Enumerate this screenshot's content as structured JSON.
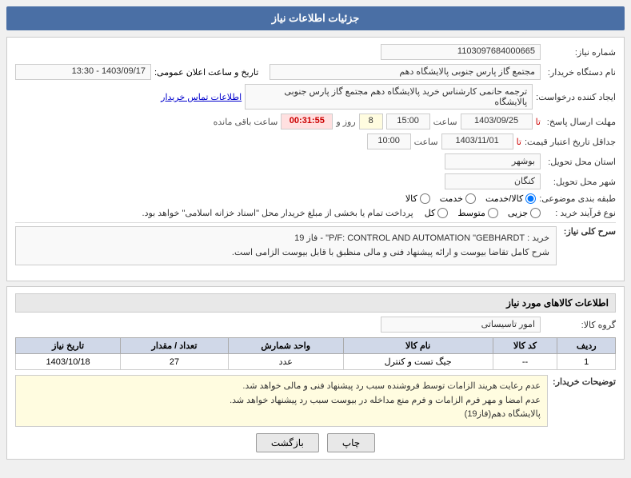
{
  "header": {
    "title": "جزئیات اطلاعات نیاز"
  },
  "fields": {
    "shomareNiaz_label": "شماره نیاز:",
    "shomareNiaz_value": "1103097684000665",
    "namDastgah_label": "نام دستگاه خریدار:",
    "namDastgah_value": "مجتمع گاز پارس جنوبی  پالایشگاه دهم",
    "ijadKonande_label": "ایجاد کننده درخواست:",
    "ijadKonande_value": "ترجمه حانمی کارشناس خرید پالایشگاه دهم  مجتمع گاز پارس جنوبی  پالایشگاه",
    "ijadKonande_link": "اطلاعات تماس خریدار",
    "mohlat_label": "مهلت ارسال پاسخ:",
    "mohlat_ta": "تا",
    "date1_value": "1403/09/25",
    "time1_value": "15:00",
    "rooz_label": "روز و",
    "rooz_value": "8",
    "countdown_value": "00:31:55",
    "saat_mande_label": "ساعت باقی مانده",
    "jadval_label": "جداقل تاریخ اعتبار قیمت:",
    "jadval_ta": "تا",
    "date2_value": "1403/11/01",
    "time2_value": "10:00",
    "ostan_label": "استان محل تحویل:",
    "ostan_value": "بوشهر",
    "shahr_label": "شهر محل تحویل:",
    "shahr_value": "کنگان",
    "tabaghebandi_label": "طبقه بندی موضوعی:",
    "tabaghebandi_options": [
      "کالا",
      "خدمت",
      "کالا/خدمت"
    ],
    "tabaghebandi_selected": "کالا/خدمت",
    "noFarayand_label": "نوع فرآیند خرید :",
    "noFarayand_options": [
      "جزیی",
      "متوسط",
      "کل"
    ],
    "noFarayand_note": "پرداخت تمام یا بخشی از مبلغ خریدار محل \"اسناد خزانه اسلامی\" خواهد بود.",
    "serh_label": "سرح کلی نیاز:",
    "serh_line1": "خرید : P/F: CONTROL AND AUTOMATION \"GEBHARDT\"  - فاز 19",
    "serh_line2": "شرح کامل تقاضا بیوست و ارائه پیشنهاد فنی و مالی منظبق با قابل بیوست الزامی است."
  },
  "kalaInfo": {
    "title": "اطلاعات کالاهای مورد نیاز",
    "goroheKala_label": "گروه کالا:",
    "goroheKala_value": "امور تاسیساتی",
    "table": {
      "headers": [
        "ردیف",
        "کد کالا",
        "نام کالا",
        "واحد شمارش",
        "تعداد / مقدار",
        "تاریخ نیاز"
      ],
      "rows": [
        {
          "radif": "1",
          "kod": "--",
          "nam": "جیگ تست و کنترل",
          "vahed": "عدد",
          "tedad": "27",
          "tarikh": "1403/10/18"
        }
      ]
    }
  },
  "notes": {
    "label": "توضیحات خریدار:",
    "line1": "عدم رعایت هریند الزامات توسط فروشنده سبب رد پیشنهاد فنی و مالی خواهد شد.",
    "line2": "عدم امضا و مهر فرم الزامات و فرم منع مداخله در بیوست سبب رد پیشنهاد خواهد شد.",
    "line3": "پالایشگاه دهم(فاز19)"
  },
  "buttons": {
    "chap": "چاپ",
    "bazgasht": "بازگشت"
  }
}
